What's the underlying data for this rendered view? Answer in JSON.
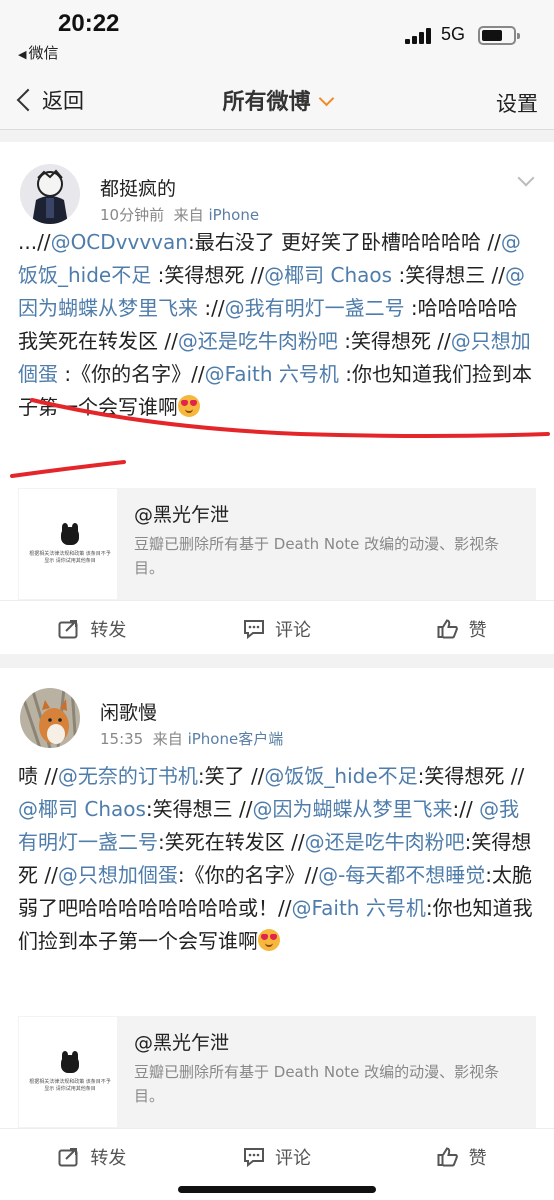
{
  "status_bar": {
    "time": "20:22",
    "back_app": "微信",
    "network": "5G"
  },
  "nav": {
    "back_label": "返回",
    "title": "所有微博",
    "settings_label": "设置"
  },
  "posts": [
    {
      "username": "都挺疯的",
      "time": "10分钟前",
      "source_prefix": "来自",
      "source": "iPhone",
      "body_segments": [
        {
          "t": "...//"
        },
        {
          "t": "@OCDvvvvan",
          "m": true
        },
        {
          "t": ":最右没了 更好笑了卧槽哈哈哈哈 //"
        },
        {
          "t": "@饭饭_hide不足",
          "m": true
        },
        {
          "t": " :笑得想死 //"
        },
        {
          "t": "@椰司 Chaos",
          "m": true
        },
        {
          "t": " :笑得想三 //"
        },
        {
          "t": "@因为蝴蝶从梦里飞来",
          "m": true
        },
        {
          "t": " ://"
        },
        {
          "t": "@我有明灯一盏二号",
          "m": true
        },
        {
          "t": " :哈哈哈哈哈我笑死在转发区 //"
        },
        {
          "t": "@还是吃牛肉粉吧",
          "m": true
        },
        {
          "t": " :笑得想死 //"
        },
        {
          "t": "@只想加個蛋",
          "m": true
        },
        {
          "t": " :《你的名字》//"
        },
        {
          "t": "@Faith 六号机",
          "m": true
        },
        {
          "t": " :你也知道我们捡到本子第一个会写谁啊"
        }
      ],
      "shared": {
        "title": "@黑光乍泄",
        "desc": "豆瓣已删除所有基于 Death Note 改编的动漫、影视条目。",
        "thumb_caption": "根据相关法律法规和政策 该条目不予显示 请你试用其他条目"
      },
      "actions": {
        "repost": "转发",
        "comment": "评论",
        "like": "赞"
      }
    },
    {
      "username": "闲歌慢",
      "time": "15:35",
      "source_prefix": "来自",
      "source": "iPhone客户端",
      "body_segments": [
        {
          "t": "啧 //"
        },
        {
          "t": "@无奈的订书机",
          "m": true
        },
        {
          "t": ":笑了 //"
        },
        {
          "t": "@饭饭_hide不足",
          "m": true
        },
        {
          "t": ":笑得想死 //"
        },
        {
          "t": "@椰司 Chaos",
          "m": true
        },
        {
          "t": ":笑得想三 //"
        },
        {
          "t": "@因为蝴蝶从梦里飞来",
          "m": true
        },
        {
          "t": ":// "
        },
        {
          "t": "@我有明灯一盏二号",
          "m": true
        },
        {
          "t": ":笑死在转发区 //"
        },
        {
          "t": "@还是吃牛肉粉吧",
          "m": true
        },
        {
          "t": ":笑得想死 //"
        },
        {
          "t": "@只想加個蛋",
          "m": true
        },
        {
          "t": ":《你的名字》//"
        },
        {
          "t": "@-每天都不想睡觉",
          "m": true
        },
        {
          "t": ":太脆弱了吧哈哈哈哈哈哈哈哈或！//"
        },
        {
          "t": "@Faith 六号机",
          "m": true
        },
        {
          "t": ":你也知道我们捡到本子第一个会写谁啊"
        }
      ],
      "shared": {
        "title": "@黑光乍泄",
        "desc": "豆瓣已删除所有基于 Death Note 改编的动漫、影视条目。",
        "thumb_caption": "根据相关法律法规和政策 该条目不予显示 请你试用其他条目"
      },
      "actions": {
        "repost": "转发",
        "comment": "评论",
        "like": "赞"
      }
    }
  ],
  "colors": {
    "mention": "#4f7dab",
    "accent_orange": "#f08a24",
    "annotation_red": "#e4262b"
  },
  "icons": [
    "back-chevron-icon",
    "dropdown-arrow-icon",
    "expand-caret-icon",
    "repost-icon",
    "comment-icon",
    "like-icon",
    "heart-eyes-emoji-icon",
    "signal-icon",
    "battery-icon"
  ]
}
